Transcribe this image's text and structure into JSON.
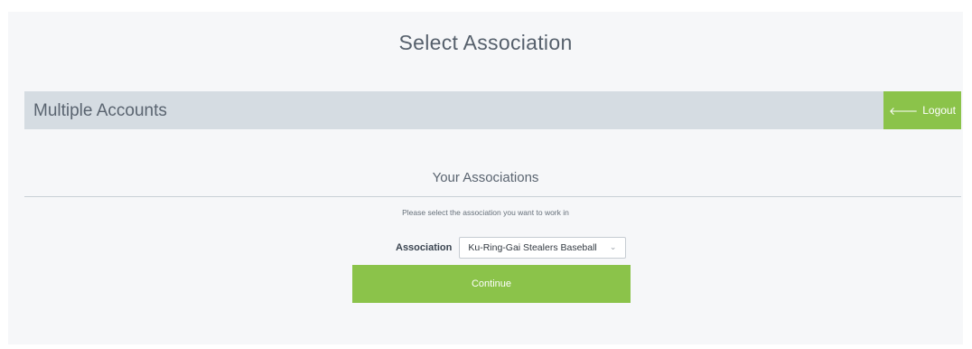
{
  "page": {
    "title": "Select Association"
  },
  "header": {
    "title": "Multiple Accounts",
    "logout_label": "Logout",
    "logout_icon": "arrow-left-icon"
  },
  "associations": {
    "section_title": "Your Associations",
    "instruction": "Please select the association you want to work in",
    "field_label": "Association",
    "selected_value": "Ku-Ring-Gai Stealers Baseball",
    "continue_label": "Continue"
  },
  "colors": {
    "accent_green": "#8bc34a",
    "header_bg": "#d5dce2",
    "panel_bg": "#f6f7f9"
  }
}
